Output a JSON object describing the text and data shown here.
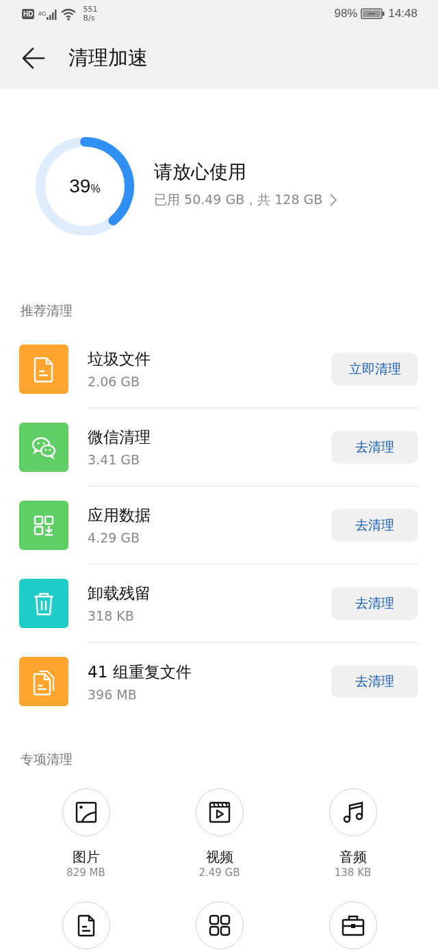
{
  "status_bar": {
    "hd_badge": "HD",
    "network_type": "4G",
    "speed_value": "551",
    "speed_unit": "B/s",
    "battery_percent": "98%",
    "time": "14:48"
  },
  "header": {
    "title": "清理加速"
  },
  "storage": {
    "value": "39",
    "unit": "%",
    "status": "请放心使用",
    "usage": "已用 50.49 GB，共 128 GB"
  },
  "recommended": {
    "title": "推荐清理",
    "items": [
      {
        "kind": "document",
        "color": "#ffa42c",
        "name": "垃圾文件",
        "size": "2.06 GB",
        "action": "立即清理"
      },
      {
        "kind": "chat",
        "color": "#5fcf65",
        "name": "微信清理",
        "size": "3.41 GB",
        "action": "去清理"
      },
      {
        "kind": "apps",
        "color": "#5fcf65",
        "name": "应用数据",
        "size": "4.29 GB",
        "action": "去清理"
      },
      {
        "kind": "trash",
        "color": "#1ecdc8",
        "name": "卸载残留",
        "size": "318 KB",
        "action": "去清理"
      },
      {
        "kind": "copies",
        "color": "#ffa42c",
        "name": "41 组重复文件",
        "size": "396 MB",
        "action": "去清理"
      }
    ]
  },
  "special": {
    "title": "专项清理",
    "items": [
      {
        "kind": "image",
        "name": "图片",
        "size": "829 MB"
      },
      {
        "kind": "video",
        "name": "视频",
        "size": "2.49 GB"
      },
      {
        "kind": "music",
        "name": "音频",
        "size": "138 KB"
      },
      {
        "kind": "document"
      },
      {
        "kind": "apps"
      },
      {
        "kind": "briefcase"
      }
    ]
  }
}
